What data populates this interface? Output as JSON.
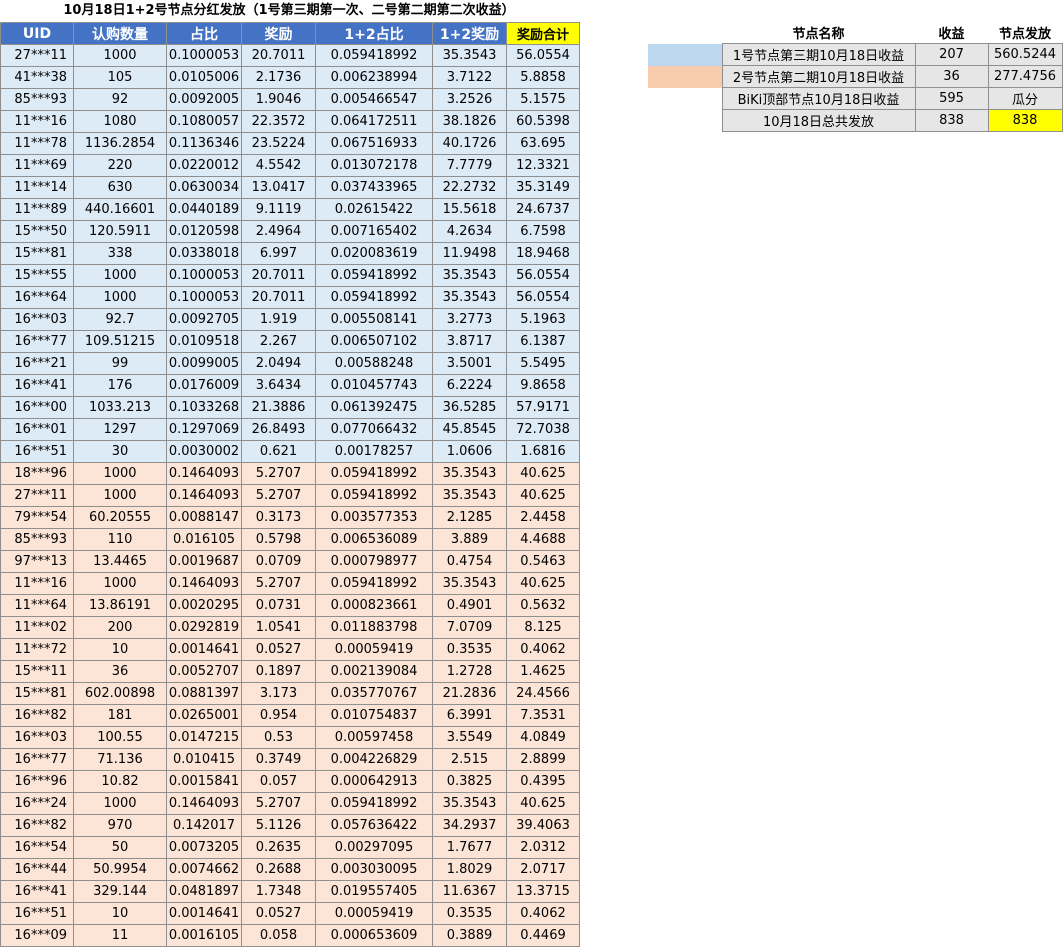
{
  "title": "10月18日1+2号节点分红发放（1号第三期第一次、二号第二期第二次收益）",
  "colors": {
    "header": "#4472c4",
    "group1": "#ddebf7",
    "group2": "#fce4d6",
    "highlight": "#ffff00",
    "swatch1": "#bdd7ee",
    "swatch2": "#f8cbad"
  },
  "main_table": {
    "columns": [
      "UID",
      "认购数量",
      "占比",
      "奖励",
      "1+2占比",
      "1+2奖励",
      "奖励合计"
    ],
    "group1": [
      [
        "27***11",
        "1000",
        "0.1000053",
        "20.7011",
        "0.059418992",
        "35.3543",
        "56.0554"
      ],
      [
        "41***38",
        "105",
        "0.0105006",
        "2.1736",
        "0.006238994",
        "3.7122",
        "5.8858"
      ],
      [
        "85***93",
        "92",
        "0.0092005",
        "1.9046",
        "0.005466547",
        "3.2526",
        "5.1575"
      ],
      [
        "11***16",
        "1080",
        "0.1080057",
        "22.3572",
        "0.064172511",
        "38.1826",
        "60.5398"
      ],
      [
        "11***78",
        "1136.2854",
        "0.1136346",
        "23.5224",
        "0.067516933",
        "40.1726",
        "63.695"
      ],
      [
        "11***69",
        "220",
        "0.0220012",
        "4.5542",
        "0.013072178",
        "7.7779",
        "12.3321"
      ],
      [
        "11***14",
        "630",
        "0.0630034",
        "13.0417",
        "0.037433965",
        "22.2732",
        "35.3149"
      ],
      [
        "11***89",
        "440.16601",
        "0.0440189",
        "9.1119",
        "0.02615422",
        "15.5618",
        "24.6737"
      ],
      [
        "15***50",
        "120.5911",
        "0.0120598",
        "2.4964",
        "0.007165402",
        "4.2634",
        "6.7598"
      ],
      [
        "15***81",
        "338",
        "0.0338018",
        "6.997",
        "0.020083619",
        "11.9498",
        "18.9468"
      ],
      [
        "15***55",
        "1000",
        "0.1000053",
        "20.7011",
        "0.059418992",
        "35.3543",
        "56.0554"
      ],
      [
        "16***64",
        "1000",
        "0.1000053",
        "20.7011",
        "0.059418992",
        "35.3543",
        "56.0554"
      ],
      [
        "16***03",
        "92.7",
        "0.0092705",
        "1.919",
        "0.005508141",
        "3.2773",
        "5.1963"
      ],
      [
        "16***77",
        "109.51215",
        "0.0109518",
        "2.267",
        "0.006507102",
        "3.8717",
        "6.1387"
      ],
      [
        "16***21",
        "99",
        "0.0099005",
        "2.0494",
        "0.00588248",
        "3.5001",
        "5.5495"
      ],
      [
        "16***41",
        "176",
        "0.0176009",
        "3.6434",
        "0.010457743",
        "6.2224",
        "9.8658"
      ],
      [
        "16***00",
        "1033.213",
        "0.1033268",
        "21.3886",
        "0.061392475",
        "36.5285",
        "57.9171"
      ],
      [
        "16***01",
        "1297",
        "0.1297069",
        "26.8493",
        "0.077066432",
        "45.8545",
        "72.7038"
      ],
      [
        "16***51",
        "30",
        "0.0030002",
        "0.621",
        "0.00178257",
        "1.0606",
        "1.6816"
      ]
    ],
    "group2": [
      [
        "18***96",
        "1000",
        "0.1464093",
        "5.2707",
        "0.059418992",
        "35.3543",
        "40.625"
      ],
      [
        "27***11",
        "1000",
        "0.1464093",
        "5.2707",
        "0.059418992",
        "35.3543",
        "40.625"
      ],
      [
        "79***54",
        "60.20555",
        "0.0088147",
        "0.3173",
        "0.003577353",
        "2.1285",
        "2.4458"
      ],
      [
        "85***93",
        "110",
        "0.016105",
        "0.5798",
        "0.006536089",
        "3.889",
        "4.4688"
      ],
      [
        "97***13",
        "13.4465",
        "0.0019687",
        "0.0709",
        "0.000798977",
        "0.4754",
        "0.5463"
      ],
      [
        "11***16",
        "1000",
        "0.1464093",
        "5.2707",
        "0.059418992",
        "35.3543",
        "40.625"
      ],
      [
        "11***64",
        "13.86191",
        "0.0020295",
        "0.0731",
        "0.000823661",
        "0.4901",
        "0.5632"
      ],
      [
        "11***02",
        "200",
        "0.0292819",
        "1.0541",
        "0.011883798",
        "7.0709",
        "8.125"
      ],
      [
        "11***72",
        "10",
        "0.0014641",
        "0.0527",
        "0.00059419",
        "0.3535",
        "0.4062"
      ],
      [
        "15***11",
        "36",
        "0.0052707",
        "0.1897",
        "0.002139084",
        "1.2728",
        "1.4625"
      ],
      [
        "15***81",
        "602.00898",
        "0.0881397",
        "3.173",
        "0.035770767",
        "21.2836",
        "24.4566"
      ],
      [
        "16***82",
        "181",
        "0.0265001",
        "0.954",
        "0.010754837",
        "6.3991",
        "7.3531"
      ],
      [
        "16***03",
        "100.55",
        "0.0147215",
        "0.53",
        "0.00597458",
        "3.5549",
        "4.0849"
      ],
      [
        "16***77",
        "71.136",
        "0.010415",
        "0.3749",
        "0.004226829",
        "2.515",
        "2.8899"
      ],
      [
        "16***96",
        "10.82",
        "0.0015841",
        "0.057",
        "0.000642913",
        "0.3825",
        "0.4395"
      ],
      [
        "16***24",
        "1000",
        "0.1464093",
        "5.2707",
        "0.059418992",
        "35.3543",
        "40.625"
      ],
      [
        "16***82",
        "970",
        "0.142017",
        "5.1126",
        "0.057636422",
        "34.2937",
        "39.4063"
      ],
      [
        "16***54",
        "50",
        "0.0073205",
        "0.2635",
        "0.00297095",
        "1.7677",
        "2.0312"
      ],
      [
        "16***44",
        "50.9954",
        "0.0074662",
        "0.2688",
        "0.003030095",
        "1.8029",
        "2.0717"
      ],
      [
        "16***41",
        "329.144",
        "0.0481897",
        "1.7348",
        "0.019557405",
        "11.6367",
        "13.3715"
      ],
      [
        "16***51",
        "10",
        "0.0014641",
        "0.0527",
        "0.00059419",
        "0.3535",
        "0.4062"
      ],
      [
        "16***09",
        "11",
        "0.0016105",
        "0.058",
        "0.000653609",
        "0.3889",
        "0.4469"
      ]
    ]
  },
  "summary": {
    "headers": [
      "节点名称",
      "收益",
      "节点发放"
    ],
    "rows": [
      {
        "swatch": "blue",
        "name": "1号节点第三期10月18日收益",
        "income": "207",
        "payout": "560.5244"
      },
      {
        "swatch": "peach",
        "name": "2号节点第二期10月18日收益",
        "income": "36",
        "payout": "277.4756"
      },
      {
        "swatch": "none",
        "name": "BiKi顶部节点10月18日收益",
        "income": "595",
        "payout": "瓜分"
      },
      {
        "swatch": "none",
        "name": "10月18日总共发放",
        "income": "838",
        "payout": "838",
        "highlight": true
      }
    ]
  }
}
